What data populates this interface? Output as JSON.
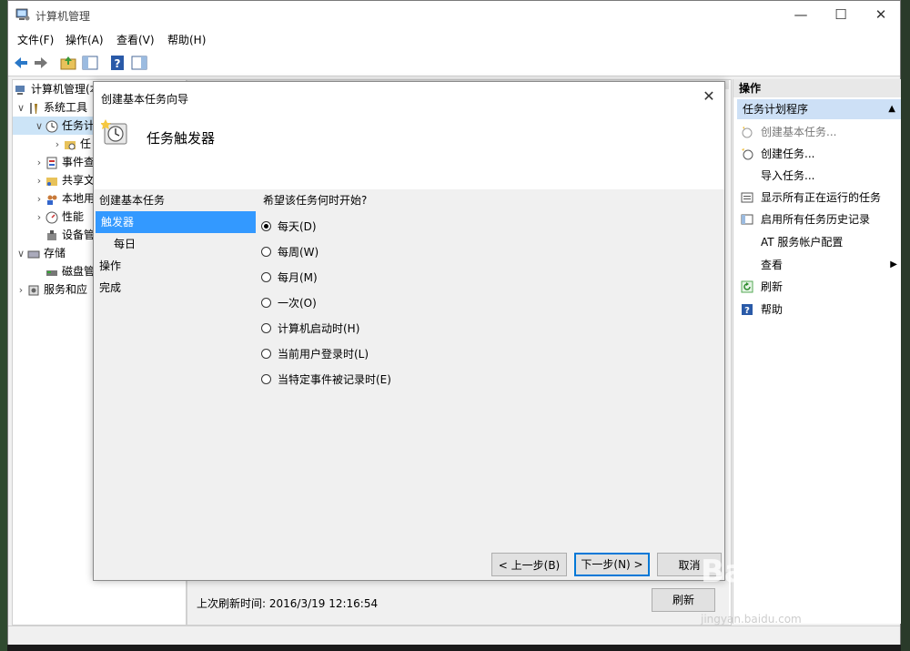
{
  "window": {
    "title": "计算机管理",
    "controls": {
      "minimize": "—",
      "maximize": "☐",
      "close": "✕"
    }
  },
  "menu": [
    "文件(F)",
    "操作(A)",
    "查看(V)",
    "帮助(H)"
  ],
  "tree": {
    "root": "计算机管理(本",
    "system_tools": "系统工具",
    "task_scheduler": "任务计",
    "task_lib": "任",
    "event_viewer": "事件查",
    "shared_folders": "共享文",
    "local_users": "本地用",
    "performance": "性能",
    "device_manager": "设备管",
    "storage": "存储",
    "disk_mgmt": "磁盘管",
    "services": "服务和应"
  },
  "center": {
    "last_refresh": "上次刷新时间: 2016/3/19 12:16:54",
    "refresh": "刷新"
  },
  "actions": {
    "header": "操作",
    "subheader": "任务计划程序",
    "items": [
      "创建基本任务...",
      "创建任务...",
      "导入任务...",
      "显示所有正在运行的任务",
      "启用所有任务历史记录",
      "AT 服务帐户配置",
      "查看",
      "刷新",
      "帮助"
    ]
  },
  "dialog": {
    "title": "创建基本任务向导",
    "close": "✕",
    "heading": "任务触发器",
    "steps": [
      "创建基本任务",
      "触发器",
      "每日",
      "操作",
      "完成"
    ],
    "question": "希望该任务何时开始?",
    "options": [
      {
        "label": "每天(D)",
        "checked": true
      },
      {
        "label": "每周(W)",
        "checked": false
      },
      {
        "label": "每月(M)",
        "checked": false
      },
      {
        "label": "一次(O)",
        "checked": false
      },
      {
        "label": "计算机启动时(H)",
        "checked": false
      },
      {
        "label": "当前用户登录时(L)",
        "checked": false
      },
      {
        "label": "当特定事件被记录时(E)",
        "checked": false
      }
    ],
    "buttons": {
      "back": "< 上一步(B)",
      "next": "下一步(N) >",
      "cancel": "取消"
    }
  },
  "watermark": {
    "brand": "Bai du 经验",
    "url": "jingyan.baidu.com"
  },
  "colors": {
    "selection": "#3399ff",
    "action_header": "#cde0f6",
    "primary_border": "#0078d7"
  }
}
